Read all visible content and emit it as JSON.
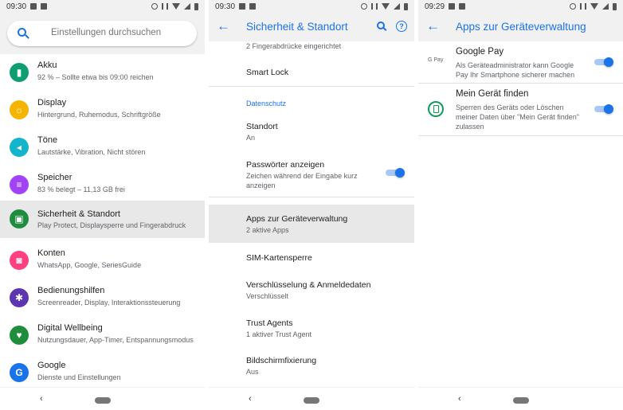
{
  "panel1": {
    "status_time": "09:30",
    "search_placeholder": "Einstellungen durchsuchen",
    "items": [
      {
        "title": "Akku",
        "sub": "92 % – Sollte etwa bis 09:00 reichen",
        "color": "#0f9d73",
        "glyph": "▮"
      },
      {
        "title": "Display",
        "sub": "Hintergrund, Ruhemodus, Schriftgröße",
        "color": "#f4b400",
        "glyph": "☼"
      },
      {
        "title": "Töne",
        "sub": "Lautstärke, Vibration, Nicht stören",
        "color": "#12b5cb",
        "glyph": "◂"
      },
      {
        "title": "Speicher",
        "sub": "83 % belegt – 11,13 GB frei",
        "color": "#a142f4",
        "glyph": "≡"
      },
      {
        "title": "Sicherheit & Standort",
        "sub": "Play Protect, Displaysperre und Fingerabdruck",
        "color": "#1e8e3e",
        "glyph": "▣"
      },
      {
        "title": "Konten",
        "sub": "WhatsApp, Google, SeriesGuide",
        "color": "#ff4081",
        "glyph": "◙"
      },
      {
        "title": "Bedienungshilfen",
        "sub": "Screenreader, Display, Interaktionssteuerung",
        "color": "#5e35b1",
        "glyph": "✱"
      },
      {
        "title": "Digital Wellbeing",
        "sub": "Nutzungsdauer, App-Timer, Entspannungsmodus",
        "color": "#1e8e3e",
        "glyph": "♥"
      },
      {
        "title": "Google",
        "sub": "Dienste und Einstellungen",
        "color": "#1a73e8",
        "glyph": "G"
      }
    ]
  },
  "panel2": {
    "status_time": "09:30",
    "title": "Sicherheit & Standort",
    "fingerprint_sub": "2 Fingerabdrücke eingerichtet",
    "smart_lock": "Smart Lock",
    "section_privacy": "Datenschutz",
    "location_title": "Standort",
    "location_sub": "An",
    "passwords_title": "Passwörter anzeigen",
    "passwords_sub": "Zeichen während der Eingabe kurz anzeigen",
    "admin_title": "Apps zur Geräteverwaltung",
    "admin_sub": "2 aktive Apps",
    "sim_title": "SIM-Kartensperre",
    "encrypt_title": "Verschlüsselung & Anmeldedaten",
    "encrypt_sub": "Verschlüsselt",
    "trust_title": "Trust Agents",
    "trust_sub": "1 aktiver Trust Agent",
    "pin_title": "Bildschirmfixierung",
    "pin_sub": "Aus"
  },
  "panel3": {
    "status_time": "09:29",
    "title": "Apps zur Geräteverwaltung",
    "gpay_logo": "G Pay",
    "gpay_title": "Google Pay",
    "gpay_sub": "Als Geräteadministrator kann Google Pay Ihr Smartphone sicherer machen",
    "find_title": "Mein Gerät finden",
    "find_sub": "Sperren des Geräts oder Löschen meiner Daten über \"Mein Gerät finden\" zulassen"
  },
  "nav": {
    "back_glyph": "‹"
  }
}
